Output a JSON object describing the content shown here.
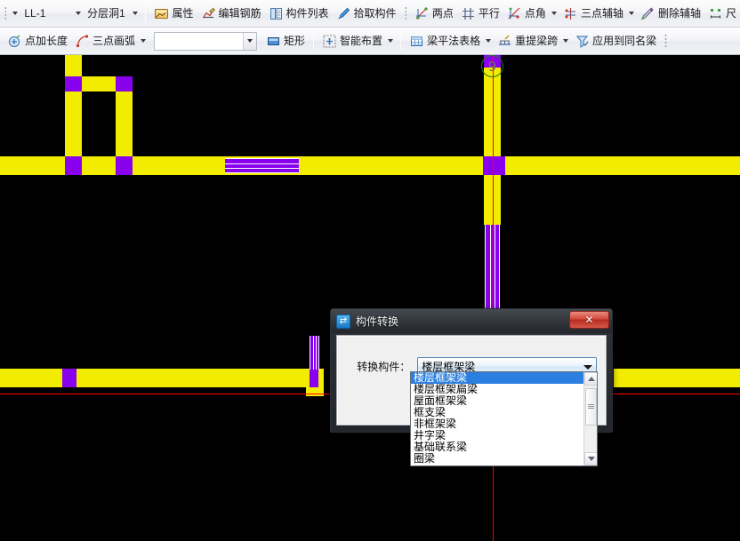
{
  "app": {
    "colors": {
      "yellow": "#F2EC00",
      "purple": "#8800EE",
      "magenta": "#FF00E8",
      "axis_red": "#FF0000",
      "axis_green": "#1F7A2E",
      "selection_white": "#FFFFFF"
    }
  },
  "toolbar_row_1": {
    "combo_component": {
      "value": "LL-1",
      "caret": "chevron-down-icon"
    },
    "combo_layer": {
      "value": "分层洞1",
      "caret": "chevron-down-icon"
    },
    "items": [
      {
        "label": "属性",
        "icon": "properties-icon"
      },
      {
        "label": "编辑钢筋",
        "icon": "edit-rebar-icon"
      },
      {
        "label": "构件列表",
        "icon": "component-list-icon"
      },
      {
        "label": "拾取构件",
        "icon": "pick-component-icon"
      },
      {
        "label": "两点",
        "icon": "two-point-icon"
      },
      {
        "label": "平行",
        "icon": "parallel-icon"
      },
      {
        "label": "点角",
        "icon": "point-angle-icon",
        "has_caret": true
      },
      {
        "label": "三点辅轴",
        "icon": "three-point-aux-axis-icon",
        "has_caret": true
      },
      {
        "label": "删除辅轴",
        "icon": "delete-aux-axis-icon"
      },
      {
        "label": "尺",
        "icon": "dimension-icon"
      }
    ]
  },
  "toolbar_row_2": {
    "items_left": [
      {
        "label": "点加长度",
        "icon": "point-add-length-icon"
      },
      {
        "label": "三点画弧",
        "icon": "three-point-arc-icon",
        "has_caret": true
      }
    ],
    "combo_empty": {
      "value": "",
      "caret": "chevron-down-icon"
    },
    "items_right": [
      {
        "label": "矩形",
        "icon": "rectangle-icon"
      },
      {
        "label": "智能布置",
        "icon": "smart-layout-icon",
        "has_caret": true
      },
      {
        "label": "梁平法表格",
        "icon": "beam-table-icon",
        "has_caret": true
      },
      {
        "label": "重提梁跨",
        "icon": "re-extract-span-icon",
        "has_caret": true
      },
      {
        "label": "应用到同名梁",
        "icon": "apply-same-name-icon"
      }
    ]
  },
  "canvas": {
    "axis_bubble_label": "9"
  },
  "dialog": {
    "title": "构件转换",
    "title_icon": "convert-icon",
    "close_label": "✕",
    "combo_label": "转换构件：",
    "combo_value": "楼层框架梁",
    "combo_arrow_icon": "chevron-down-icon",
    "dropdown_options": [
      "楼层框架梁",
      "楼层框架扁梁",
      "屋面框架梁",
      "框支梁",
      "非框架梁",
      "井字梁",
      "基础联系梁",
      "圈梁"
    ],
    "dropdown_selected_index": 0,
    "scroll_up_icon": "scroll-up-arrow-icon",
    "scroll_down_icon": "scroll-down-arrow-icon"
  }
}
